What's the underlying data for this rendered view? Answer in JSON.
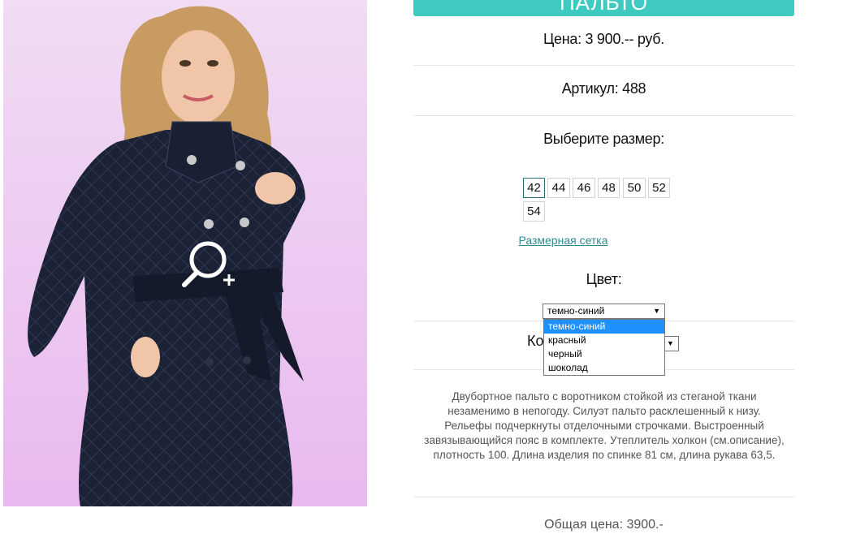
{
  "product": {
    "title": "ПАЛЬТО",
    "price": "Цена: 3 900.-- руб.",
    "article": "Артикул: 488",
    "image_alt": "photo of quilted double-breasted coat"
  },
  "sizes": {
    "label": "Выберите размер:",
    "options": [
      "42",
      "44",
      "46",
      "48",
      "50",
      "52",
      "54"
    ],
    "selected": "42",
    "chart_link": "Размерная сетка"
  },
  "color": {
    "label": "Цвет:",
    "selected": "темно-синий",
    "options": [
      "темно-синий",
      "красный",
      "черный",
      "шоколад"
    ]
  },
  "quantity": {
    "label": "Ко"
  },
  "description": "Двубортное пальто с воротником стойкой из стеганой ткани незаменимо в непогоду. Силуэт пальто расклешенный к низу. Рельефы подчеркнуты отделочными строчками. Выстроенный завязывающийся пояс в комплекте. Утеплитель холкон (см.описание), плотность 100. Длина изделия по спинке 81 см, длина рукава 63,5.",
  "total": "Общая цена: 3900.-",
  "colors": {
    "accent": "#3ec9c1",
    "link": "#2e8b92",
    "dropdown_highlight": "#1e90ff"
  },
  "icons": {
    "zoom": "zoom-in-icon",
    "select_arrow": "dropdown-arrow-icon"
  }
}
